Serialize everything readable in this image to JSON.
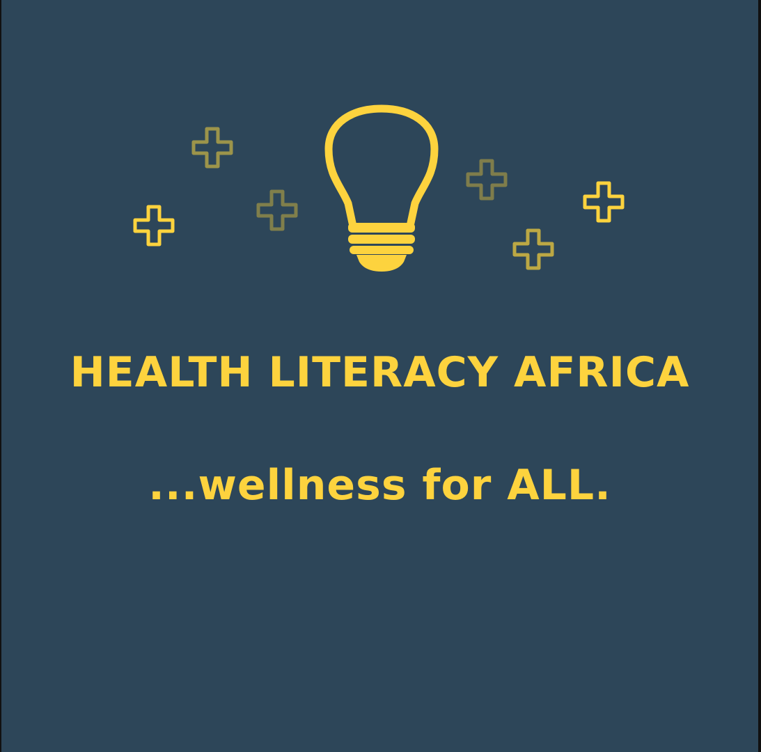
{
  "brand": {
    "title": "HEALTH LITERACY AFRICA",
    "tagline": "...wellness for ALL."
  },
  "colors": {
    "background": "#2d4659",
    "accent": "#fdd33e",
    "accent_muted": "#8c8a4c"
  },
  "icons": {
    "main": "lightbulb-icon",
    "decorations": "plus-icon"
  }
}
